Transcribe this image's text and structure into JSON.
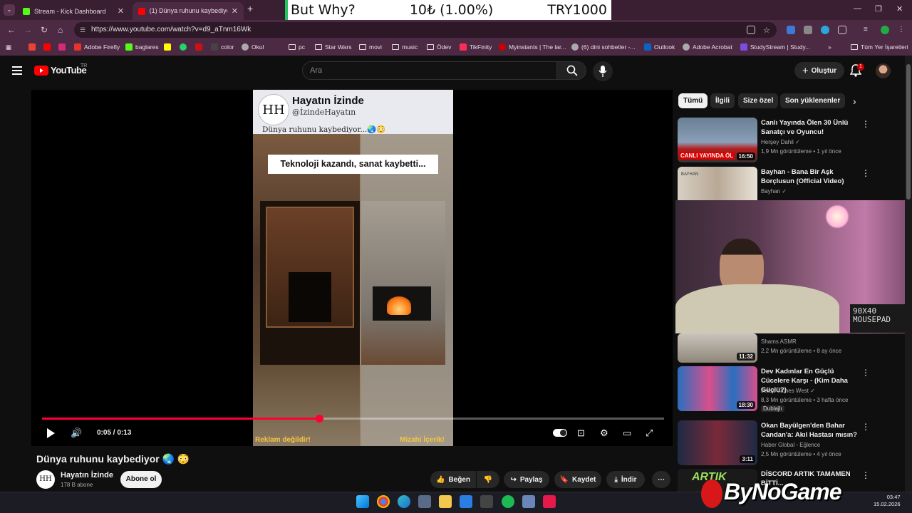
{
  "browser": {
    "tabs": [
      {
        "label": "Stream - Kick Dashboard"
      },
      {
        "label": "(1) Dünya ruhunu kaybediyor 🌏 😳"
      }
    ],
    "url": "https://www.youtube.com/watch?v=d9_aTnm16Wk",
    "bookmarks": [
      "Adobe Firefly",
      "baglares",
      "color",
      "Okul",
      "pc",
      "Star Wars",
      "movi",
      "music",
      "Ödev",
      "TikFinity",
      "Myinstants | The lar...",
      "(6) dini sohbetler -...",
      "Outlook",
      "Adobe Acrobat",
      "StudyStream | Study...",
      "Tüm Yer İşaretleri"
    ]
  },
  "overlay_banner": {
    "left": "But Why?",
    "middle": "10₺ (1.00%)",
    "right": "TRY1000"
  },
  "youtube": {
    "logo_text": "YouTube",
    "country": "TR",
    "search_placeholder": "Ara",
    "create_label": "Oluştur",
    "notification_count": "1"
  },
  "video": {
    "overlay_channel": "Hayatın İzinde",
    "overlay_handle": "@İzindeHayatın",
    "overlay_subtitle": "Dünya ruhunu kaybediyor...🌏😳",
    "avatar_text": "HH",
    "caption": "Teknoloji kazandı, sanat kaybetti...",
    "tag_left": "Reklam değildir!",
    "tag_right": "Mizahi İçerik!",
    "time": "0:05 / 0:13",
    "progress": 0.446
  },
  "below": {
    "title": "Dünya ruhunu kaybediyor 🌏 😳",
    "channel": "Hayatın İzinde",
    "subs": "178 B abone",
    "subscribe": "Abone ol",
    "like": "Beğen",
    "share": "Paylaş",
    "save": "Kaydet",
    "download": "İndir"
  },
  "chips": [
    "Tümü",
    "İlgili",
    "Size özel",
    "Son yüklenenler"
  ],
  "recs": [
    {
      "title": "Canlı Yayında Ölen 30 Ünlü Sanatçı ve Oyuncu!",
      "channel": "Herşey Dahil ✓",
      "meta": "1,9 Mn görüntüleme • 1 yıl önce",
      "dur": "16:50",
      "thumb_text": "CANLI YAYINDA ÖL"
    },
    {
      "title": "Bayhan - Bana Bir Aşk Borçlusun (Official Video)",
      "channel": "Bayhan ✓",
      "meta": "",
      "dur": "",
      "thumb_text": "BAYHAN"
    },
    {
      "title": "",
      "channel": "Shams ASMR",
      "meta": "2,2 Mn görüntüleme • 8 ay önce",
      "dur": "11:32",
      "thumb_text": ""
    },
    {
      "title": "Dev Kadınlar En Güçlü Cücelere Karşı - (Kim Daha Güçlü?)",
      "channel": "Jesse James West ✓",
      "meta": "8,3 Mn görüntüleme • 3 hafta önce",
      "badge": "Dublajlı",
      "dur": "18:30",
      "thumb_text": ""
    },
    {
      "title": "Okan Bayülgen'den Bahar Candan'a: Akıl Hastası mısın?",
      "channel": "Haber Global - Eğlence",
      "meta": "2,5 Mn görüntüleme • 4 yıl önce",
      "dur": "3:11",
      "thumb_text": ""
    },
    {
      "title": "DİSCORD ARTIK TAMAMEN BİTTİ...",
      "channel": "",
      "meta": "",
      "dur": "",
      "thumb_text": "ARTIK"
    }
  ],
  "webcam": {
    "pad_text": "90X40 MOUSEPAD"
  },
  "taskbar": {
    "time": "03:47",
    "date": "15.02.2026"
  },
  "watermark": "ByNoGame",
  "colors": {
    "accent": "#ff0033",
    "chrome": "#4c2a44",
    "banner_bar": "#22c55e"
  }
}
